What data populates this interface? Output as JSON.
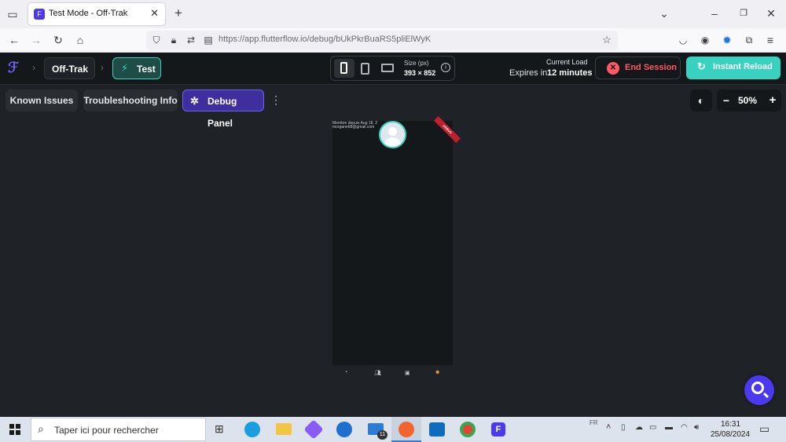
{
  "browser": {
    "tab_title": "Test Mode - Off-Trak",
    "url": "https://app.flutterflow.io/debug/bUkPkrBuaRS5pliElWyK",
    "new_tab": "+",
    "close": "✕"
  },
  "app": {
    "project_name": "Off-Trak",
    "mode_label": "Test",
    "size_label": "Size (px)",
    "size_value": "393 × 852",
    "current_load": "Current Load",
    "expires_prefix": "Expires in",
    "expires_value": "12 minutes",
    "end_session": "End Session",
    "instant_reload": "Instant Reload"
  },
  "toolbar": {
    "known_issues": "Known Issues",
    "troubleshooting": "Troubleshooting Info",
    "debug_panel": "Debug Panel",
    "zoom": "50%",
    "zoom_minus": "−",
    "zoom_plus": "+"
  },
  "preview": {
    "member_text": "Membre depuis Aug 18, 2",
    "email_text": "morgane68@gmail.com",
    "debug_ribbon": "DEBUG"
  },
  "taskbar": {
    "search_placeholder": "Taper ici pour rechercher",
    "lang": "FR",
    "time": "16:31",
    "date": "25/08/2024",
    "mail_badge": "11"
  },
  "colors": {
    "accent_purple": "#4b39ef",
    "accent_teal": "#39d2c0",
    "danger": "#ff5963"
  }
}
